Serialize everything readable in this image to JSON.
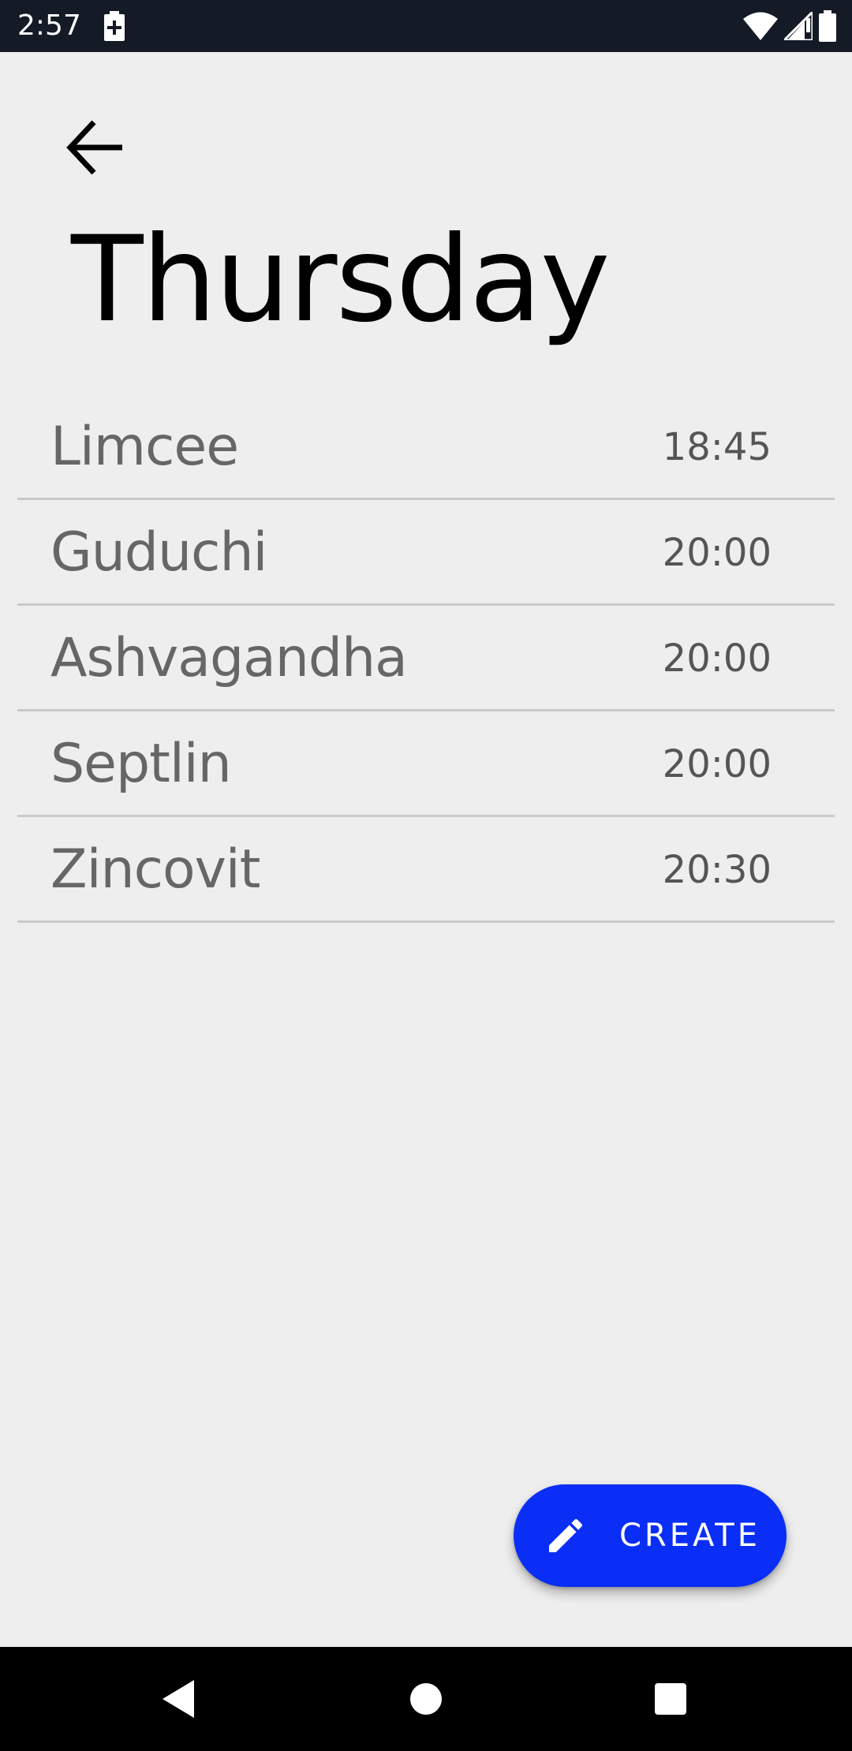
{
  "status_bar": {
    "time": "2:57",
    "icons": [
      "battery-saver-icon",
      "wifi-icon",
      "cell-signal-icon",
      "battery-icon"
    ]
  },
  "header": {
    "back_icon": "arrow-left-icon",
    "title": "Thursday"
  },
  "medications": [
    {
      "name": "Limcee",
      "time": "18:45"
    },
    {
      "name": "Guduchi",
      "time": "20:00"
    },
    {
      "name": "Ashvagandha",
      "time": "20:00"
    },
    {
      "name": "Septlin",
      "time": "20:00"
    },
    {
      "name": "Zincovit",
      "time": "20:30"
    }
  ],
  "fab": {
    "icon": "pencil-icon",
    "label": "CREATE",
    "color": "#0a2ef5"
  },
  "nav_bar": {
    "icons": [
      "back-triangle-icon",
      "home-circle-icon",
      "recents-square-icon"
    ]
  },
  "colors": {
    "background": "#eeeeee",
    "status_bar": "#141a26",
    "divider": "#c9c9c9",
    "name_text": "#666666"
  }
}
